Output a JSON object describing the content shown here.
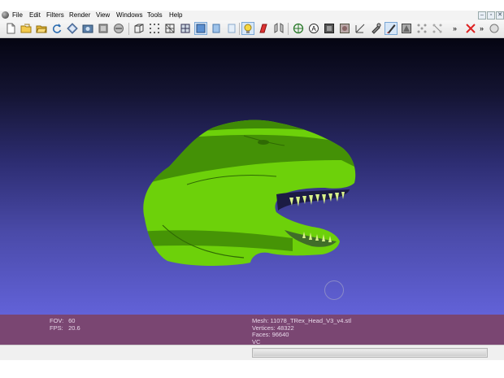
{
  "menubar": {
    "items": [
      "File",
      "Edit",
      "Filters",
      "Render",
      "View",
      "Windows",
      "Tools",
      "Help"
    ],
    "window_controls": [
      "–",
      "▫",
      "✕"
    ]
  },
  "toolbar": {
    "icons": [
      "new-file-icon",
      "open-file-icon",
      "open-folder-icon",
      "reload-icon",
      "import-icon",
      "snapshot-icon",
      "mesh-stack-icon",
      "disk-icon",
      "bounding-box-icon",
      "points-icon",
      "wireframe-icon",
      "hidden-lines-icon",
      "flat-shading-icon",
      "smooth-shading-icon",
      "texture-icon",
      "light-bulb-icon",
      "lighting-mode-icon",
      "double-side-icon",
      "layers-icon",
      "annotation-icon",
      "color-icon",
      "texture-view-icon",
      "measure-icon",
      "pick-icon",
      "paint-icon",
      "select-faces-icon",
      "select-vertices-icon",
      "clear-selection-icon"
    ],
    "overflow_labels": [
      "»",
      "»"
    ]
  },
  "info": {
    "fov_label": "FOV:",
    "fov_value": "60",
    "fps_label": "FPS:",
    "fps_value": "20.6",
    "mesh": "Mesh: 11078_TRex_Head_V3_v4.stl",
    "vertices": "Vertices: 48322",
    "faces": "Faces: 96640",
    "vc": "VC"
  },
  "colors": {
    "mesh": "#6dd10a",
    "mesh_dark": "#3f8a06",
    "info_bar": "#7a4672",
    "viewport_top": "#050512",
    "viewport_bottom": "#6262d8"
  }
}
